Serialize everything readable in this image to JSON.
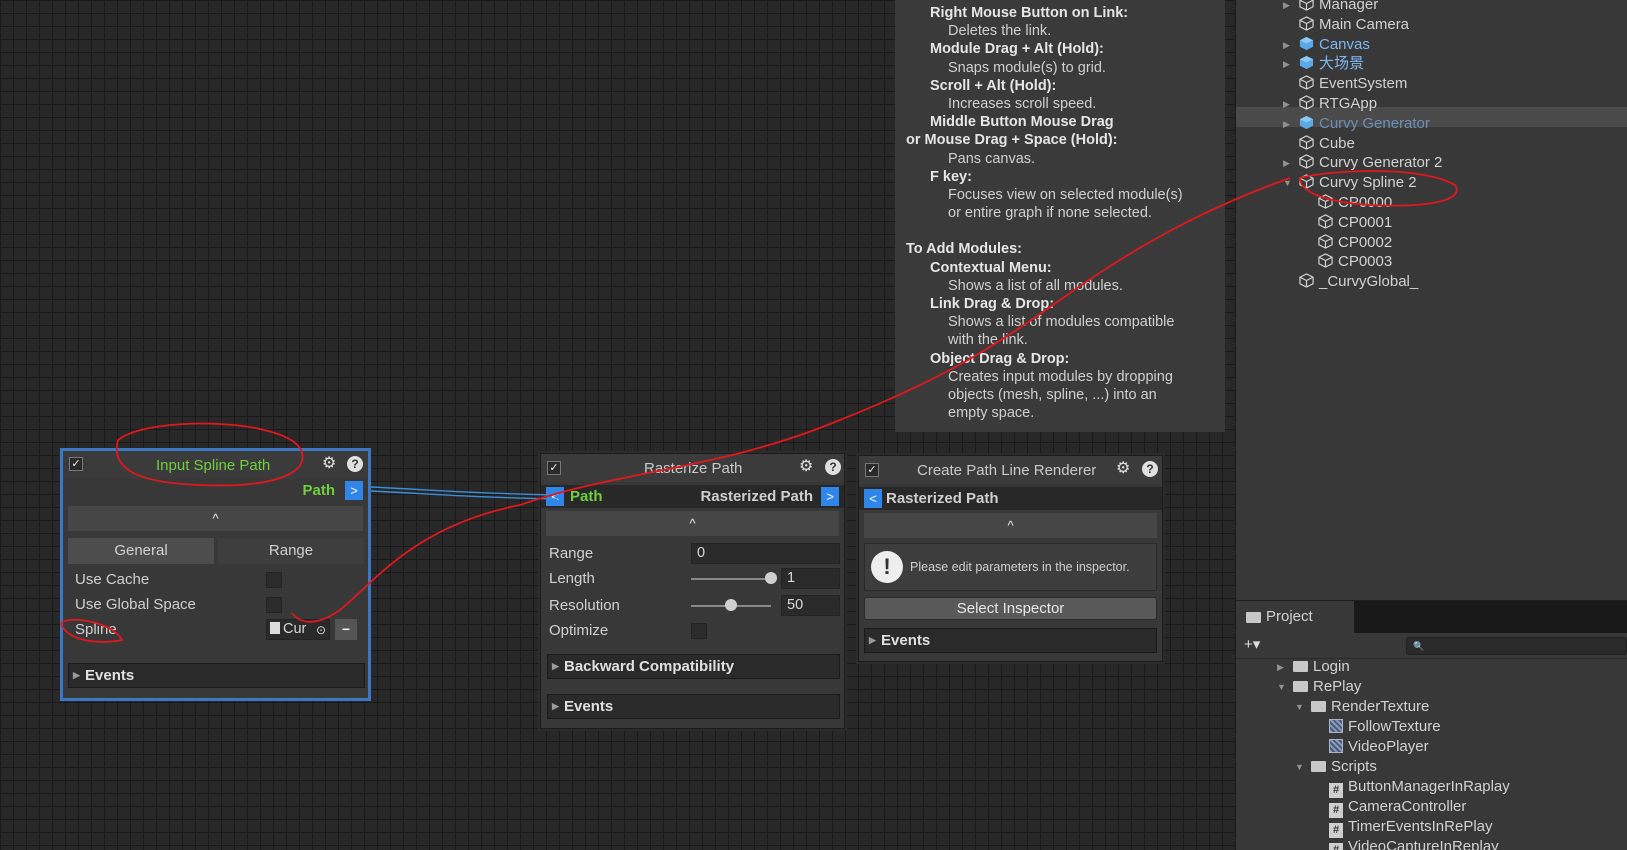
{
  "help": {
    "lines": [
      {
        "k": "h",
        "text": "Right Mouse Button on Link:"
      },
      {
        "k": "s",
        "text": "Deletes the link."
      },
      {
        "k": "h",
        "text": "Module Drag + Alt (Hold):"
      },
      {
        "k": "s",
        "text": "Snaps module(s) to grid."
      },
      {
        "k": "h",
        "text": "Scroll + Alt (Hold):"
      },
      {
        "k": "s",
        "text": "Increases scroll speed."
      },
      {
        "k": "h",
        "text": "Middle Button Mouse Drag"
      },
      {
        "k": "t",
        "text": "or Mouse Drag + Space (Hold):"
      },
      {
        "k": "s",
        "text": "Pans canvas."
      },
      {
        "k": "h",
        "text": "F key:"
      },
      {
        "k": "s",
        "text": "Focuses view on selected module(s)"
      },
      {
        "k": "s",
        "text": "or entire graph if none selected."
      },
      {
        "k": "gap",
        "text": ""
      },
      {
        "k": "t",
        "text": "To Add Modules:"
      },
      {
        "k": "h",
        "text": "Contextual Menu:"
      },
      {
        "k": "s",
        "text": "Shows a list of all modules."
      },
      {
        "k": "h",
        "text": "Link Drag & Drop:"
      },
      {
        "k": "s",
        "text": "Shows a list of modules compatible"
      },
      {
        "k": "s",
        "text": "with the link."
      },
      {
        "k": "h",
        "text": "Object Drag & Drop:"
      },
      {
        "k": "s",
        "text": "Creates input modules by dropping"
      },
      {
        "k": "s",
        "text": "objects (mesh, spline, ...) into  an"
      },
      {
        "k": "s",
        "text": "empty space."
      }
    ]
  },
  "node_input": {
    "title": "Input Spline Path",
    "out_port": "Path",
    "out_port_glyph": ">",
    "collapse_glyph": "^",
    "tabs": [
      "General",
      "Range"
    ],
    "use_cache": "Use Cache",
    "use_global_space": "Use Global Space",
    "spline_label": "Spline",
    "spline_value": "Cur",
    "minus_glyph": "−",
    "events": "Events"
  },
  "node_raster": {
    "title": "Rasterize Path",
    "in_port": "Path",
    "in_port_glyph": "<",
    "out_port": "Rasterized Path",
    "out_port_glyph": ">",
    "collapse_glyph": "^",
    "range_label": "Range",
    "range_value": "0",
    "length_label": "Length",
    "length_value": "1",
    "length_level": 1.0,
    "resolution_label": "Resolution",
    "resolution_value": "50",
    "resolution_level": 0.5,
    "optimize_label": "Optimize",
    "backward": "Backward Compatibility",
    "events": "Events"
  },
  "node_renderer": {
    "title": "Create Path Line Renderer",
    "in_port": "Rasterized Path",
    "in_port_glyph": "<",
    "collapse_glyph": "^",
    "warning": "Please edit parameters in the inspector.",
    "select_inspector": "Select Inspector",
    "events": "Events"
  },
  "hierarchy": {
    "items": [
      {
        "label": "Manager",
        "depth": 0,
        "arrow": "▶",
        "icon": "gameobject-icon",
        "color": "#d2d2d2"
      },
      {
        "label": "Main Camera",
        "depth": 0,
        "arrow": "",
        "icon": "gameobject-icon",
        "color": "#d2d2d2"
      },
      {
        "label": "Canvas",
        "depth": 0,
        "arrow": "▶",
        "icon": "prefab-icon",
        "color": "#7fb8f0"
      },
      {
        "label": "大场景",
        "depth": 0,
        "arrow": "▶",
        "icon": "prefab-icon",
        "color": "#7fb8f0"
      },
      {
        "label": "EventSystem",
        "depth": 0,
        "arrow": "",
        "icon": "gameobject-icon",
        "color": "#d2d2d2"
      },
      {
        "label": "RTGApp",
        "depth": 0,
        "arrow": "▶",
        "icon": "gameobject-icon",
        "color": "#d2d2d2"
      },
      {
        "label": "Curvy Generator",
        "depth": 0,
        "arrow": "▶",
        "icon": "prefab-icon",
        "color": "#6d8fb5"
      },
      {
        "label": "Cube",
        "depth": 0,
        "arrow": "",
        "icon": "gameobject-icon",
        "color": "#d2d2d2"
      },
      {
        "label": "Curvy Generator 2",
        "depth": 0,
        "arrow": "▶",
        "icon": "gameobject-icon",
        "color": "#d2d2d2"
      },
      {
        "label": "Curvy Spline 2",
        "depth": 0,
        "arrow": "▼",
        "icon": "gameobject-icon",
        "color": "#d2d2d2"
      },
      {
        "label": "CP0000",
        "depth": 1,
        "arrow": "",
        "icon": "gameobject-icon",
        "color": "#d2d2d2"
      },
      {
        "label": "CP0001",
        "depth": 1,
        "arrow": "",
        "icon": "gameobject-icon",
        "color": "#d2d2d2"
      },
      {
        "label": "CP0002",
        "depth": 1,
        "arrow": "",
        "icon": "gameobject-icon",
        "color": "#d2d2d2"
      },
      {
        "label": "CP0003",
        "depth": 1,
        "arrow": "",
        "icon": "gameobject-icon",
        "color": "#d2d2d2"
      },
      {
        "label": "_CurvyGlobal_",
        "depth": 0,
        "arrow": "",
        "icon": "gameobject-icon",
        "color": "#d2d2d2"
      }
    ]
  },
  "project": {
    "tab": "Project",
    "add_glyph": "+▾",
    "search_glyph": "🔍",
    "items": [
      {
        "label": "Login",
        "depth": 0,
        "arrow": "▶",
        "type": "folder"
      },
      {
        "label": "RePlay",
        "depth": 0,
        "arrow": "▼",
        "type": "folder"
      },
      {
        "label": "RenderTexture",
        "depth": 1,
        "arrow": "▼",
        "type": "folder"
      },
      {
        "label": "FollowTexture",
        "depth": 2,
        "arrow": "",
        "type": "texture"
      },
      {
        "label": "VideoPlayer",
        "depth": 2,
        "arrow": "",
        "type": "texture"
      },
      {
        "label": "Scripts",
        "depth": 1,
        "arrow": "▼",
        "type": "folder"
      },
      {
        "label": "ButtonManagerInRaplay",
        "depth": 2,
        "arrow": "",
        "type": "script"
      },
      {
        "label": "CameraController",
        "depth": 2,
        "arrow": "",
        "type": "script"
      },
      {
        "label": "TimerEventsInRePlay",
        "depth": 2,
        "arrow": "",
        "type": "script"
      },
      {
        "label": "VideoCaptureInReplay",
        "depth": 2,
        "arrow": "",
        "type": "script"
      }
    ]
  },
  "colors": {
    "port": "#2f86e8",
    "input_title": "#6fcf3f",
    "selection_border": "#3a78c4",
    "annotation": "#e0181e",
    "link": "#3b8ed8"
  }
}
